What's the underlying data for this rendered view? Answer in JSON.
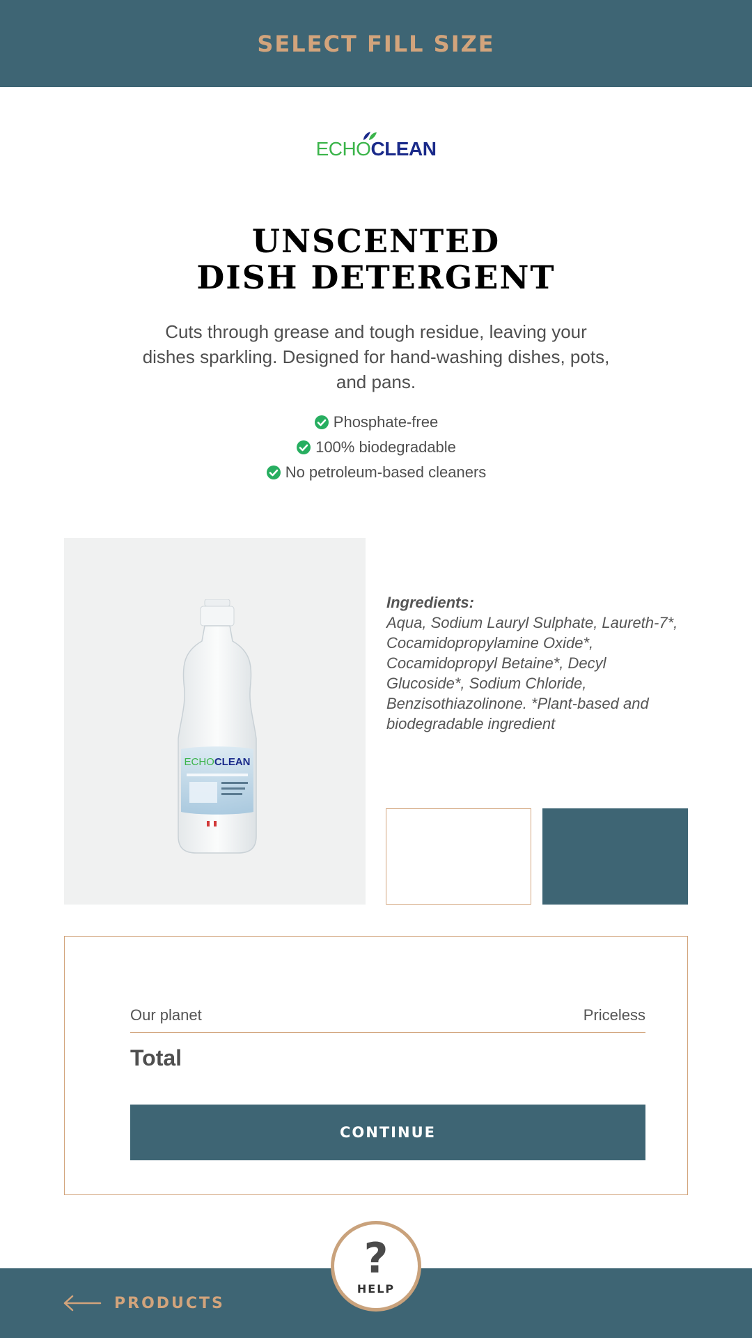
{
  "header": {
    "title": "SELECT FILL SIZE"
  },
  "brand": {
    "part1": "ECHO",
    "part2": "CLEAN"
  },
  "product": {
    "title_line1": "UNSCENTED",
    "title_line2": "DISH DETERGENT",
    "description": "Cuts through grease and tough residue, leaving your dishes sparkling. Designed for hand-washing dishes, pots, and pans.",
    "features": [
      "Phosphate-free",
      "100% biodegradable",
      "No petroleum-based cleaners"
    ]
  },
  "ingredients": {
    "heading": "Ingredients:",
    "text": "Aqua, Sodium Lauryl Sulphate, Laureth-7*, Cocamidopropylamine Oxide*, Cocamidopropyl Betaine*, Decyl Glucoside*, Sodium Chloride, Benzisothiazolinone. *Plant-based and biodegradable ingredient"
  },
  "summary": {
    "line_label": "Our planet",
    "line_value": "Priceless",
    "total_label": "Total",
    "continue_label": "CONTINUE"
  },
  "footer": {
    "back_label": "PRODUCTS",
    "help_label": "HELP",
    "help_symbol": "?"
  },
  "colors": {
    "primary": "#3e6574",
    "accent": "#d2a47c",
    "check": "#27ae60",
    "brand_green": "#3bb44a",
    "brand_blue": "#1a2a8a"
  }
}
